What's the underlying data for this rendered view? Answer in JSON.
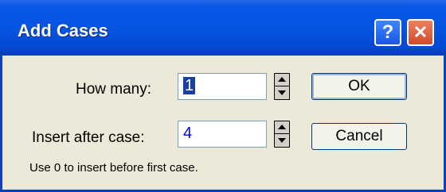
{
  "window": {
    "title": "Add Cases"
  },
  "titlebar": {
    "help_glyph": "?",
    "close_glyph": "✕"
  },
  "form": {
    "how_many_label": "How many:",
    "how_many_value": "1",
    "insert_after_label": "Insert after case:",
    "insert_after_value": "4",
    "hint": "Use 0 to insert before first case."
  },
  "buttons": {
    "ok_label": "OK",
    "cancel_label": "Cancel"
  },
  "colors": {
    "titlebar": "#0554e1",
    "dialog_bg": "#ece9d8",
    "close_button": "#d24b2a",
    "input_text": "#0000ee"
  }
}
